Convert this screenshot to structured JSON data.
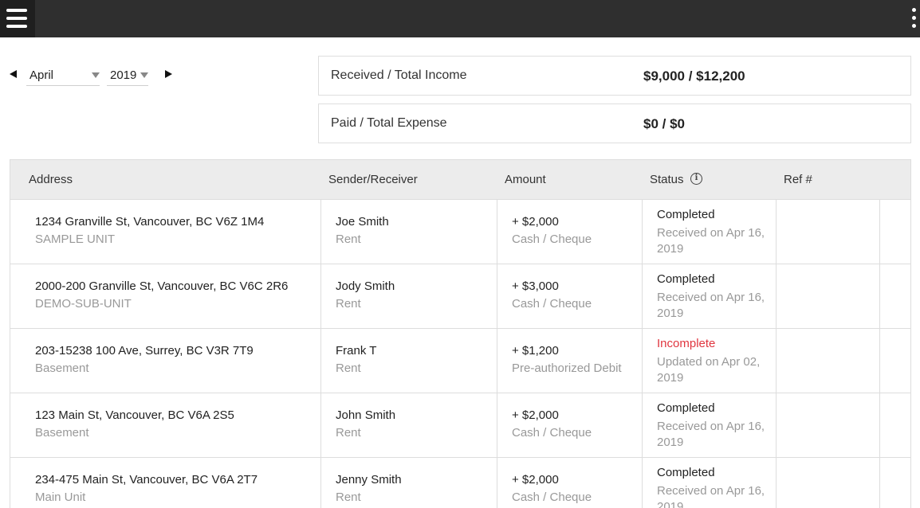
{
  "period": {
    "month": "April",
    "year": "2019"
  },
  "summary": {
    "income": {
      "label": "Received / Total Income",
      "value": "$9,000 / $12,200"
    },
    "expense": {
      "label": "Paid / Total Expense",
      "value": "$0 / $0"
    }
  },
  "table": {
    "headers": {
      "address": "Address",
      "sender": "Sender/Receiver",
      "amount": "Amount",
      "status": "Status",
      "ref": "Ref #"
    },
    "rows": [
      {
        "address": "1234 Granville St, Vancouver, BC V6Z 1M4",
        "unit": "SAMPLE UNIT",
        "name": "Joe Smith",
        "type": "Rent",
        "amount": "+ $2,000",
        "method": "Cash / Cheque",
        "status": "Completed",
        "status_detail": "Received on Apr 16, 2019"
      },
      {
        "address": "2000-200 Granville St, Vancouver, BC V6C 2R6",
        "unit": "DEMO-SUB-UNIT",
        "name": "Jody Smith",
        "type": "Rent",
        "amount": "+ $3,000",
        "method": "Cash / Cheque",
        "status": "Completed",
        "status_detail": "Received on Apr 16, 2019"
      },
      {
        "address": "203-15238 100 Ave, Surrey, BC V3R 7T9",
        "unit": "Basement",
        "name": "Frank T",
        "type": "Rent",
        "amount": "+ $1,200",
        "method": "Pre-authorized Debit",
        "status": "Incomplete",
        "status_detail": "Updated on Apr 02, 2019"
      },
      {
        "address": "123 Main St, Vancouver, BC V6A 2S5",
        "unit": "Basement",
        "name": "John Smith",
        "type": "Rent",
        "amount": "+ $2,000",
        "method": "Cash / Cheque",
        "status": "Completed",
        "status_detail": "Received on Apr 16, 2019"
      },
      {
        "address": "234-475 Main St, Vancouver, BC V6A 2T7",
        "unit": "Main Unit",
        "name": "Jenny Smith",
        "type": "Rent",
        "amount": "+ $2,000",
        "method": "Cash / Cheque",
        "status": "Completed",
        "status_detail": "Received on Apr 16, 2019"
      }
    ]
  },
  "colors": {
    "topbar": "#2f2f2f",
    "incomplete": "#e0363f",
    "muted": "#999999"
  }
}
